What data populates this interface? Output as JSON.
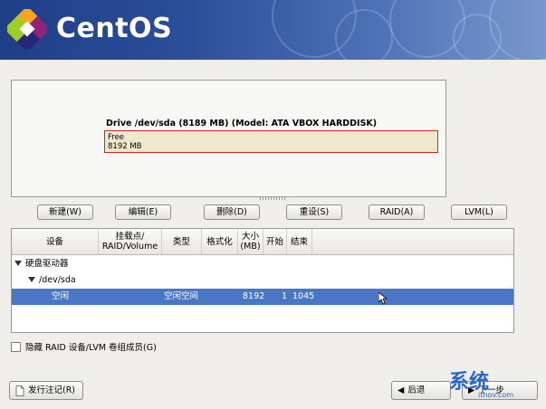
{
  "banner": {
    "logo_text": "CentOS"
  },
  "drive": {
    "title": "Drive /dev/sda (8189 MB) (Model: ATA VBOX HARDDISK)",
    "free_label": "Free",
    "free_size": "8192 MB"
  },
  "toolbar": {
    "new": "新建(W)",
    "edit": "编辑(E)",
    "delete": "删除(D)",
    "reset": "重设(S)",
    "raid": "RAID(A)",
    "lvm": "LVM(L)"
  },
  "table": {
    "headers": {
      "device": "设备",
      "mount": "挂载点/ RAID/Volume",
      "type": "类型",
      "format": "格式化",
      "size": "大小 (MB)",
      "start": "开始",
      "end": "结束"
    },
    "group": "硬盘驱动器",
    "disk": "/dev/sda",
    "row": {
      "device": "空闲",
      "type": "空闲空间",
      "size": "8192",
      "start": "1",
      "end": "1045"
    }
  },
  "options": {
    "hide_raid": "隐藏 RAID 设备/LVM 卷组成员(G)"
  },
  "footer": {
    "release_notes": "发行注记(R)",
    "back": "后退",
    "next": "下一步"
  },
  "watermark": {
    "text": "系统",
    "url": "ithov.com"
  },
  "colors": {
    "selection": "#4a77c3",
    "free_border": "#d72020",
    "free_fill": "#efe8cc"
  }
}
